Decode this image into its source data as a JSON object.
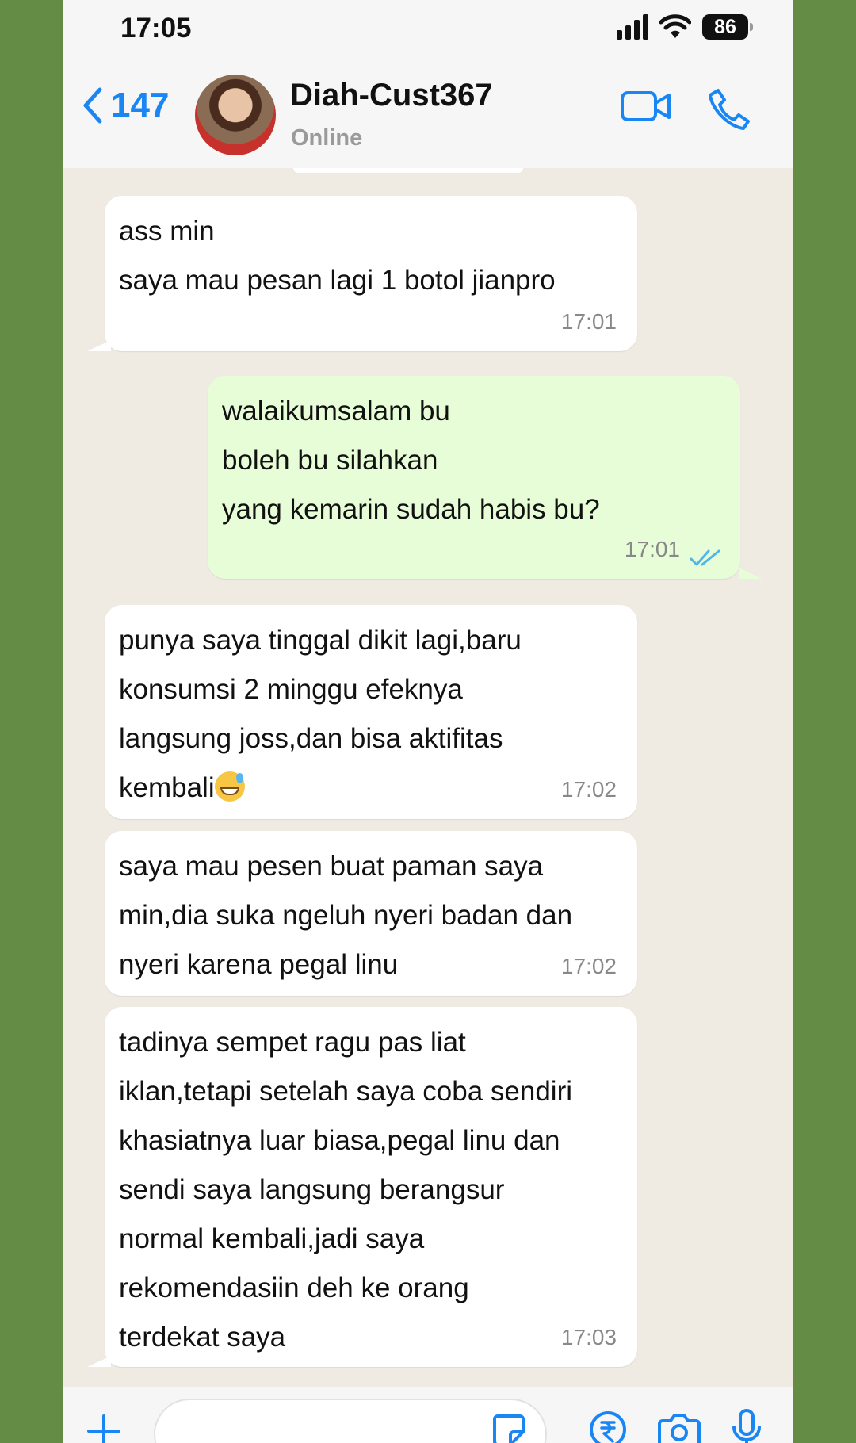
{
  "status_bar": {
    "time": "17:05",
    "battery": "86"
  },
  "header": {
    "back_count": "147",
    "contact_name": "Diah-Cust367",
    "contact_status": "Online"
  },
  "messages": [
    {
      "direction": "in",
      "lines": [
        " ass min",
        "saya mau pesan lagi 1 botol jianpro"
      ],
      "time": "17:01"
    },
    {
      "direction": "out",
      "lines": [
        " walaikumsalam bu",
        "boleh bu silahkan",
        "yang kemarin sudah habis bu?"
      ],
      "time": "17:01",
      "status": "read"
    },
    {
      "direction": "in",
      "lines": [
        " punya saya tinggal dikit lagi,baru",
        "konsumsi 2 minggu efeknya",
        "langsung joss,dan bisa aktifitas",
        "kembali"
      ],
      "emoji": "grinning-sweat",
      "time": "17:02"
    },
    {
      "direction": "in",
      "lines": [
        " saya mau pesen buat paman saya",
        "min,dia suka ngeluh nyeri badan dan",
        "nyeri karena pegal linu"
      ],
      "time": "17:02"
    },
    {
      "direction": "in",
      "lines": [
        " tadinya sempet ragu pas liat",
        "iklan,tetapi setelah saya coba sendiri",
        "khasiatnya luar biasa,pegal linu dan",
        "sendi saya langsung berangsur",
        "normal kembali,jadi saya",
        "rekomendasiin deh ke orang",
        "terdekat saya"
      ],
      "time": "17:03"
    }
  ],
  "composer": {
    "value": "",
    "icons": [
      "plus-icon",
      "sticker-icon",
      "rupee-payment-icon",
      "camera-icon",
      "microphone-icon"
    ]
  },
  "colors": {
    "accent": "#1a86f3",
    "incoming_bubble": "#ffffff",
    "outgoing_bubble": "#e7fdd7",
    "chat_background": "#efeae2",
    "frame_background": "#648c44",
    "read_ticks": "#4fb6ec"
  }
}
